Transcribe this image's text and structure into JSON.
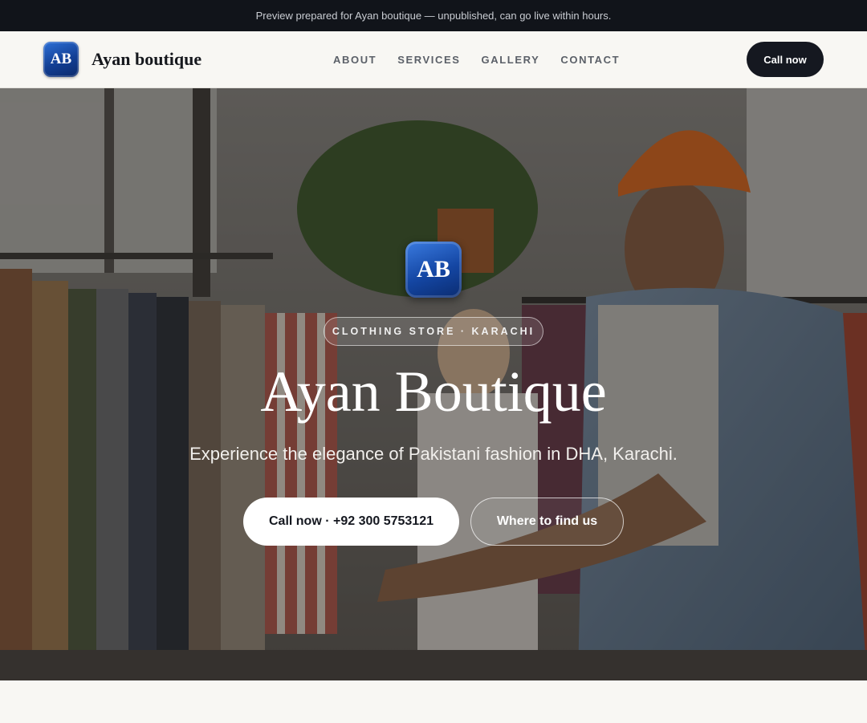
{
  "topbar": {
    "text": "Preview prepared for Ayan boutique — unpublished, can go live within hours."
  },
  "header": {
    "logo_text": "AB",
    "brand_name": "Ayan boutique",
    "nav": [
      "ABOUT",
      "SERVICES",
      "GALLERY",
      "CONTACT"
    ],
    "call_label": "Call now"
  },
  "hero": {
    "logo_text": "AB",
    "tag": "CLOTHING STORE · KARACHI",
    "title": "Ayan Boutique",
    "subtitle": "Experience the elegance of Pakistani fashion in DHA, Karachi.",
    "call_button": "Call now · +92 300 5753121",
    "find_button": "Where to find us"
  },
  "colors": {
    "topbar_bg": "#11141a",
    "accent_dark": "#151820",
    "logo_blue": "#1446a3",
    "page_bg": "#f8f7f3"
  }
}
